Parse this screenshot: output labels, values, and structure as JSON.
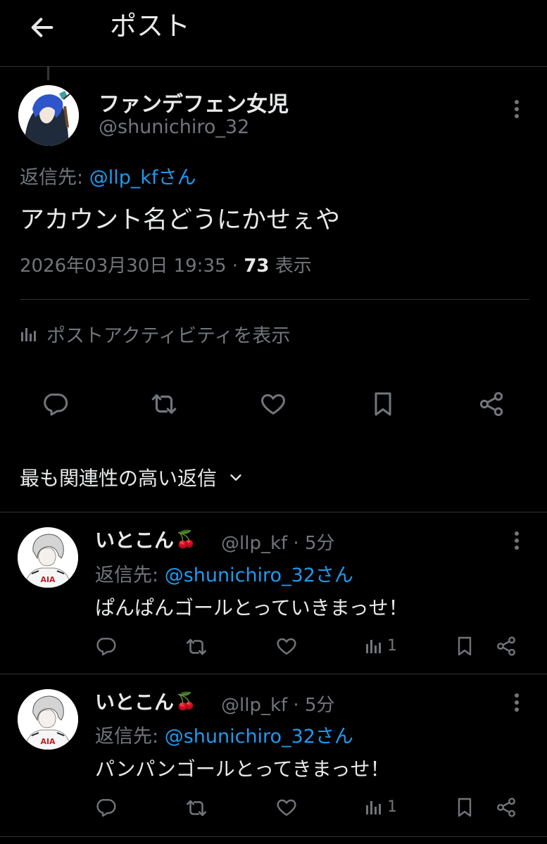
{
  "header": {
    "title": "ポスト"
  },
  "post": {
    "display_name": "ファンデフェン女児",
    "handle": "@shunichiro_32",
    "reply_prefix": "返信先: ",
    "reply_target": "@llp_kfさん",
    "text": "アカウント名どうにかせぇや",
    "datetime": "2026年03月30日 19:35 · ",
    "views": "73",
    "views_label": " 表示",
    "activity_label": "ポストアクティビティを表示"
  },
  "sort": {
    "label": "最も関連性の高い返信"
  },
  "replies": [
    {
      "name": "いとこん",
      "emoji": "🍒",
      "handle": "@llp_kf · 5分",
      "reply_prefix": "返信先: ",
      "reply_target": "@shunichiro_32さん",
      "text": "ぱんぱんゴールとっていきまっせ！",
      "view_count": "1",
      "avatar_text": "AIA"
    },
    {
      "name": "いとこん",
      "emoji": "🍒",
      "handle": "@llp_kf · 5分",
      "reply_prefix": "返信先: ",
      "reply_target": "@shunichiro_32さん",
      "text": "パンパンゴールとってきまっせ！",
      "view_count": "1",
      "avatar_text": "AIA"
    }
  ],
  "icons": {
    "back": "arrow-left-icon",
    "more": "more-vertical-icon",
    "analytics": "bar-chart-icon",
    "reply": "speech-bubble-icon",
    "repost": "repost-icon",
    "like": "heart-icon",
    "bookmark": "bookmark-icon",
    "share": "share-icon",
    "sort": "chevron-down-icon"
  },
  "colors": {
    "background": "#000000",
    "text": "#e7e9ea",
    "muted": "#71767b",
    "link": "#1d9bf0",
    "divider": "#2f3336"
  }
}
